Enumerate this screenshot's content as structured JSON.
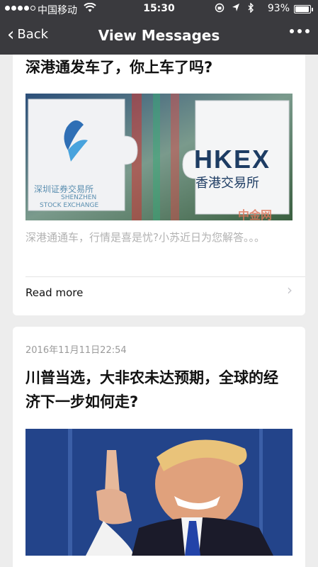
{
  "status_bar": {
    "carrier": "中国移动",
    "time": "15:30",
    "battery": "93%",
    "battery_level": 0.93
  },
  "nav": {
    "back_label": "Back",
    "title": "View Messages"
  },
  "messages": [
    {
      "title": "深港通发车了，你上车了吗?",
      "cover": {
        "left_text": "深圳证券交易所",
        "left_sub1": "SHENZHEN",
        "left_sub2": "STOCK EXCHANGE",
        "right_logo": "HKEX",
        "right_sub": "香港交易所",
        "watermark": "中金网"
      },
      "summary": "深港通通车，行情是喜是忧?小苏近日为您解答。。。",
      "read_more": "Read more"
    },
    {
      "date": "2016年11月11日22:54",
      "title": "川普当选，大非农未达预期，全球的经济下一步如何走?"
    }
  ],
  "colors": {
    "header_bg": "#3a3a3e",
    "page_bg": "#ededed",
    "card_bg": "#ffffff"
  }
}
